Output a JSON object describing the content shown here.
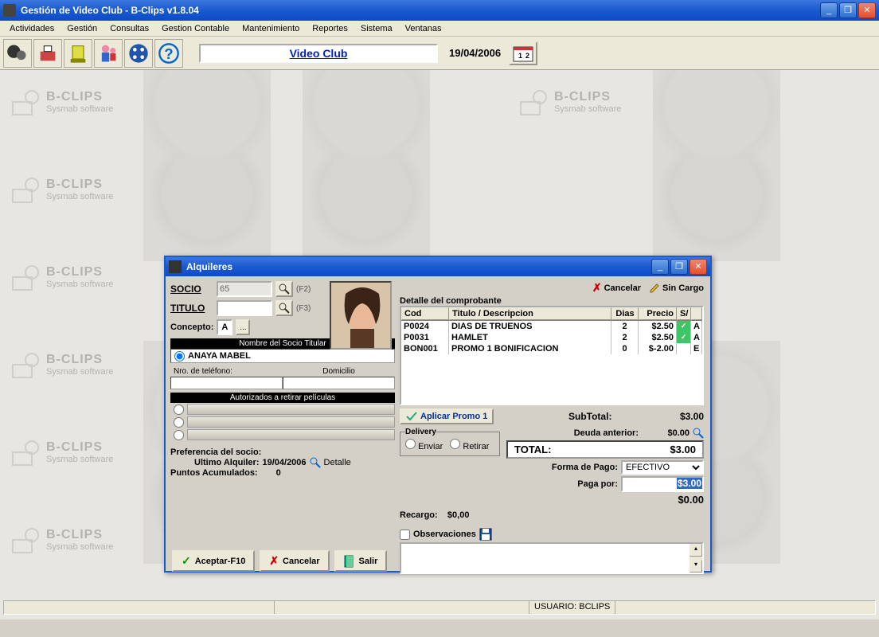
{
  "main_window": {
    "title": "Gestión de Video Club - B-Clips v1.8.04",
    "banner": "Video Club",
    "date": "19/04/2006"
  },
  "menus": [
    "Actividades",
    "Gestión",
    "Consultas",
    "Gestion Contable",
    "Mantenimiento",
    "Reportes",
    "Sistema",
    "Ventanas"
  ],
  "watermark": {
    "line1": "B-CLIPS",
    "line2": "Sysmab software"
  },
  "statusbar": {
    "user_label": "USUARIO:",
    "user_value": "BCLIPS"
  },
  "dialog": {
    "title": "Alquileres",
    "socio_label": "SOCIO",
    "socio_value": "65",
    "socio_shortcut": "(F2)",
    "titulo_label": "TITULO",
    "titulo_value": "",
    "titulo_shortcut": "(F3)",
    "concepto_label": "Concepto:",
    "concepto_value": "A",
    "nombre_header": "Nombre del Socio Titular",
    "nombre_value": "ANAYA MABEL",
    "telefono_header": "Nro. de teléfono:",
    "domicilio_header": "Domicilio",
    "autorizados_header": "Autorizados a retirar películas",
    "preferencia_label": "Preferencia del socio:",
    "ultimo_label": "Ultimo Alquiler:",
    "ultimo_value": "19/04/2006",
    "detalle_btn": "Detalle",
    "puntos_label": "Puntos Acumulados:",
    "puntos_value": "0",
    "cancelar_link": "Cancelar",
    "sincargo_link": "Sin Cargo",
    "detalle_label": "Detalle del comprobante",
    "columns": {
      "cod": "Cod",
      "tit": "Titulo / Descripcion",
      "dias": "Dias",
      "precio": "Precio",
      "so": "S/"
    },
    "rows": [
      {
        "cod": "P0024",
        "tit": "DIAS DE TRUENOS",
        "dias": "2",
        "precio": "$2.50",
        "check": true,
        "e": "A"
      },
      {
        "cod": "P0031",
        "tit": "HAMLET",
        "dias": "2",
        "precio": "$2.50",
        "check": true,
        "e": "A"
      },
      {
        "cod": "BON001",
        "tit": "PROMO   1 BONIFICACION",
        "dias": "0",
        "precio": "$-2.00",
        "check": false,
        "e": "E"
      }
    ],
    "promo_btn": "Aplicar Promo  1",
    "subtotal_label": "SubTotal:",
    "subtotal_value": "$3.00",
    "delivery_label": "Delivery",
    "delivery_enviar": "Enviar",
    "delivery_retirar": "Retirar",
    "recargo_label": "Recargo:",
    "recargo_value": "$0,00",
    "deuda_label": "Deuda anterior:",
    "deuda_value": "$0.00",
    "total_label": "TOTAL:",
    "total_value": "$3.00",
    "forma_label": "Forma de Pago:",
    "forma_value": "EFECTIVO",
    "paga_label": "Paga por:",
    "paga_value": "$3.00",
    "resto_value": "$0.00",
    "observaciones_label": "Observaciones",
    "aceptar_btn": "Aceptar-F10",
    "cancelar_btn": "Cancelar",
    "salir_btn": "Salir"
  }
}
